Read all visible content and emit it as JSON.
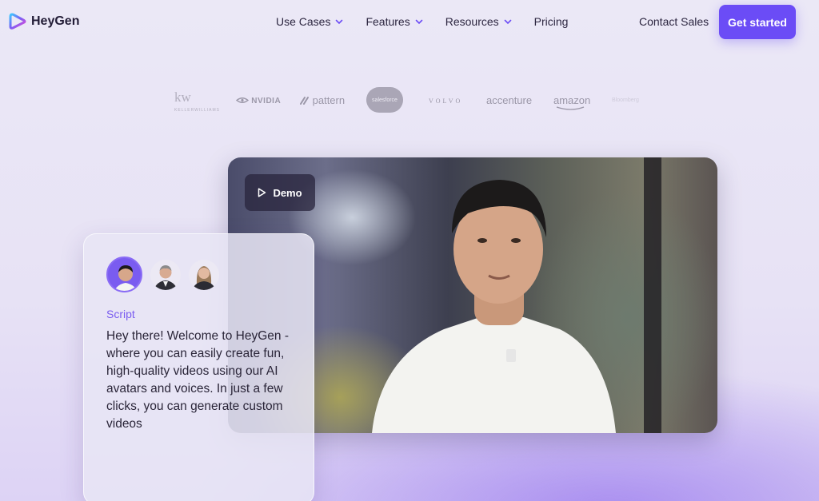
{
  "brand": {
    "name": "HeyGen",
    "accent": "#6b4cf6"
  },
  "nav": {
    "items": [
      {
        "label": "Use Cases",
        "has_dropdown": true
      },
      {
        "label": "Features",
        "has_dropdown": true
      },
      {
        "label": "Resources",
        "has_dropdown": true
      },
      {
        "label": "Pricing",
        "has_dropdown": false
      }
    ],
    "contact_label": "Contact Sales",
    "cta_label": "Get started"
  },
  "customer_logos": {
    "kw": "kw",
    "kw_sub": "KELLERWILLIAMS",
    "nvidia": "NVIDIA",
    "pattern": "pattern",
    "salesforce": "salesforce",
    "volvo": "VOLVO",
    "accenture": "accenture",
    "amazon": "amazon",
    "faded": "Bloomberg"
  },
  "video": {
    "demo_label": "Demo",
    "play_icon": "play-icon"
  },
  "script_card": {
    "label": "Script",
    "text": "Hey there! Welcome to HeyGen - where you can easily create fun, high-quality videos using our AI avatars and voices. In just a few clicks, you can generate custom videos"
  }
}
